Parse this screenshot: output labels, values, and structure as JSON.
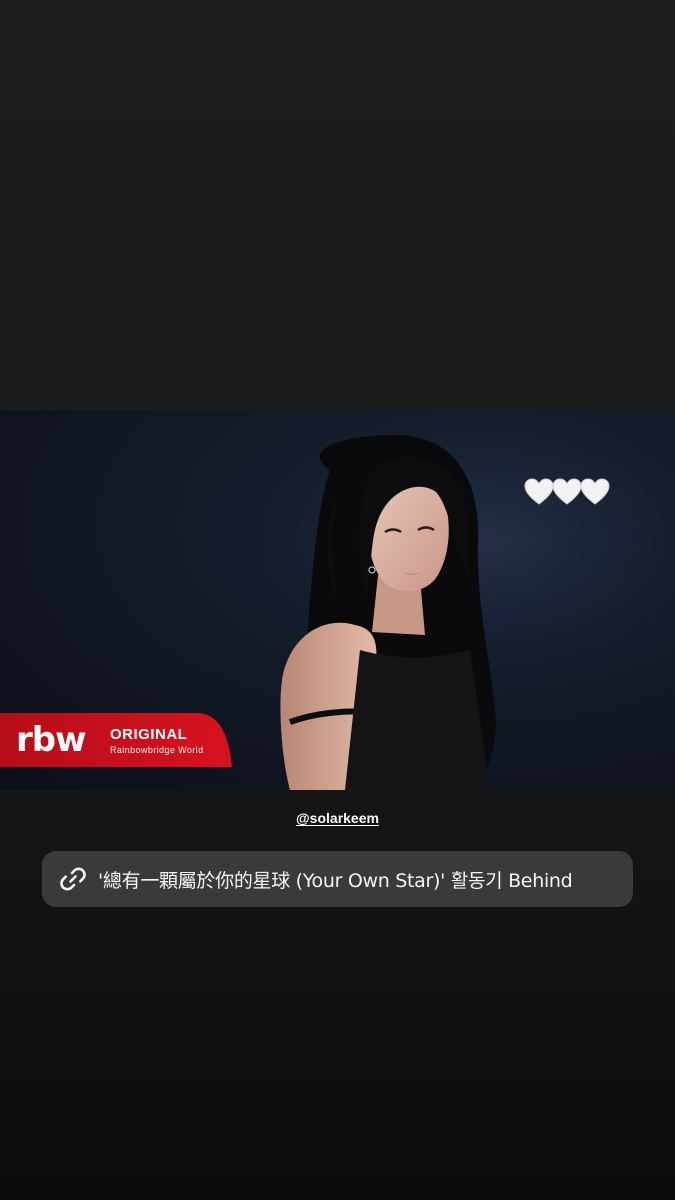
{
  "video": {
    "hearts": [
      "white-heart",
      "white-heart",
      "white-heart"
    ]
  },
  "badge": {
    "logo_text": "rbw",
    "title": "ORIGINAL",
    "subtitle": "Rainbowbridge World",
    "color": "#c8101e"
  },
  "mention": {
    "handle": "@solarkeem"
  },
  "link": {
    "text": "'總有一顆屬於你的星球 (Your Own Star)' 활동기 Behind"
  },
  "colors": {
    "background": "#1c1c1c",
    "sticker_bg": "#3a3a3a",
    "text": "#ffffff"
  }
}
